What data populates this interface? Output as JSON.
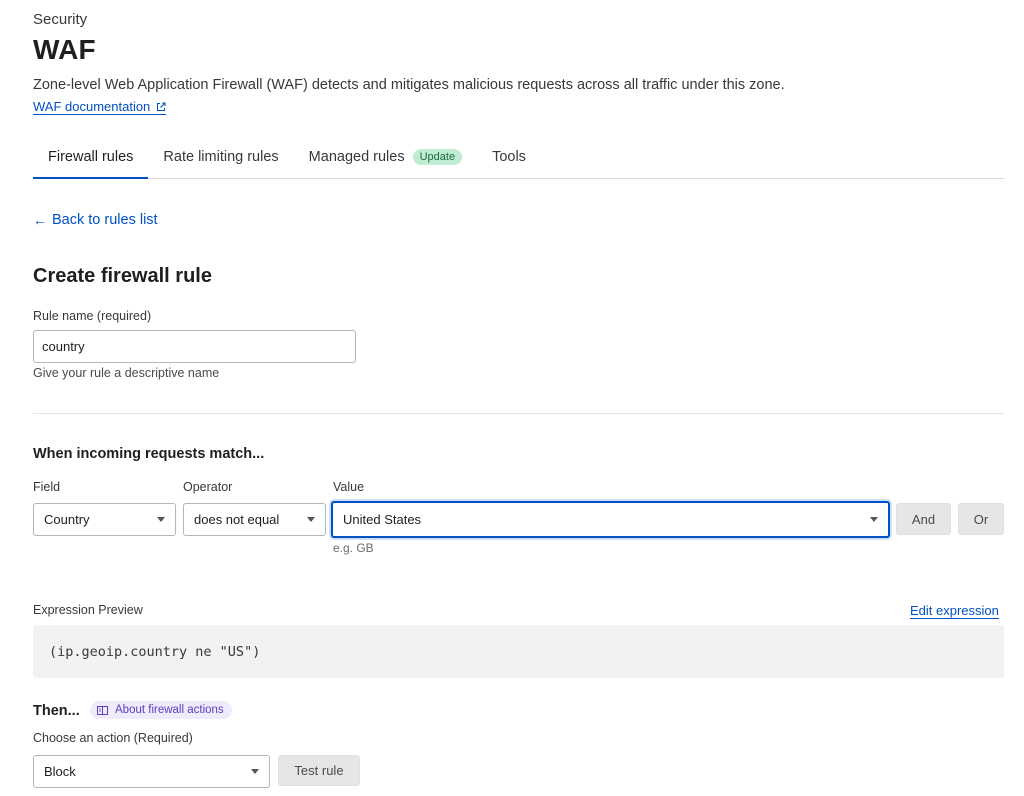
{
  "header": {
    "breadcrumb": "Security",
    "title": "WAF",
    "description": "Zone-level Web Application Firewall (WAF) detects and mitigates malicious requests across all traffic under this zone.",
    "doc_link": "WAF documentation",
    "doc_link_icon": "external-link-icon"
  },
  "tabs": [
    {
      "label": "Firewall rules",
      "active": true
    },
    {
      "label": "Rate limiting rules",
      "active": false
    },
    {
      "label": "Managed rules",
      "active": false,
      "badge": "Update"
    },
    {
      "label": "Tools",
      "active": false
    }
  ],
  "back_link": "Back to rules list",
  "form": {
    "title": "Create firewall rule",
    "rule_name": {
      "label": "Rule name (required)",
      "value": "country",
      "help": "Give your rule a descriptive name"
    },
    "match": {
      "heading": "When incoming requests match...",
      "field_label": "Field",
      "operator_label": "Operator",
      "value_label": "Value",
      "field_value": "Country",
      "operator_value": "does not equal",
      "value_value": "United States",
      "value_hint": "e.g. GB",
      "and_button": "And",
      "or_button": "Or"
    },
    "expression": {
      "label": "Expression Preview",
      "edit_link": "Edit expression",
      "code": "(ip.geoip.country ne \"US\")"
    },
    "action": {
      "heading": "Then...",
      "about_link": "About firewall actions",
      "label": "Choose an action (Required)",
      "value": "Block",
      "test_button": "Test rule"
    }
  },
  "colors": {
    "accent": "#0051c3",
    "badge_bg": "#bfecd2",
    "pill_bg": "#efeafc"
  }
}
